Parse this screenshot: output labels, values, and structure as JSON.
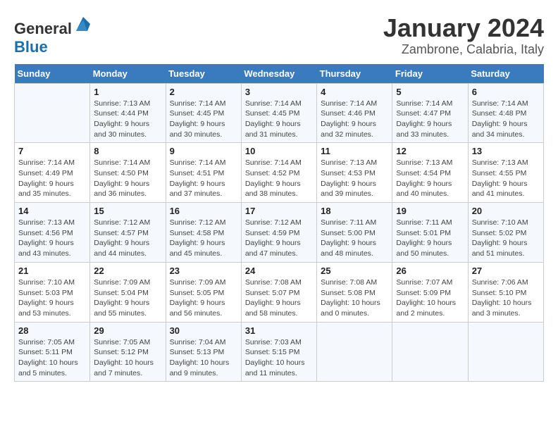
{
  "header": {
    "logo_general": "General",
    "logo_blue": "Blue",
    "title": "January 2024",
    "subtitle": "Zambrone, Calabria, Italy"
  },
  "days_of_week": [
    "Sunday",
    "Monday",
    "Tuesday",
    "Wednesday",
    "Thursday",
    "Friday",
    "Saturday"
  ],
  "weeks": [
    [
      {
        "day": "",
        "sunrise": "",
        "sunset": "",
        "daylight": ""
      },
      {
        "day": "1",
        "sunrise": "Sunrise: 7:13 AM",
        "sunset": "Sunset: 4:44 PM",
        "daylight": "Daylight: 9 hours and 30 minutes."
      },
      {
        "day": "2",
        "sunrise": "Sunrise: 7:14 AM",
        "sunset": "Sunset: 4:45 PM",
        "daylight": "Daylight: 9 hours and 30 minutes."
      },
      {
        "day": "3",
        "sunrise": "Sunrise: 7:14 AM",
        "sunset": "Sunset: 4:45 PM",
        "daylight": "Daylight: 9 hours and 31 minutes."
      },
      {
        "day": "4",
        "sunrise": "Sunrise: 7:14 AM",
        "sunset": "Sunset: 4:46 PM",
        "daylight": "Daylight: 9 hours and 32 minutes."
      },
      {
        "day": "5",
        "sunrise": "Sunrise: 7:14 AM",
        "sunset": "Sunset: 4:47 PM",
        "daylight": "Daylight: 9 hours and 33 minutes."
      },
      {
        "day": "6",
        "sunrise": "Sunrise: 7:14 AM",
        "sunset": "Sunset: 4:48 PM",
        "daylight": "Daylight: 9 hours and 34 minutes."
      }
    ],
    [
      {
        "day": "7",
        "sunrise": "Sunrise: 7:14 AM",
        "sunset": "Sunset: 4:49 PM",
        "daylight": "Daylight: 9 hours and 35 minutes."
      },
      {
        "day": "8",
        "sunrise": "Sunrise: 7:14 AM",
        "sunset": "Sunset: 4:50 PM",
        "daylight": "Daylight: 9 hours and 36 minutes."
      },
      {
        "day": "9",
        "sunrise": "Sunrise: 7:14 AM",
        "sunset": "Sunset: 4:51 PM",
        "daylight": "Daylight: 9 hours and 37 minutes."
      },
      {
        "day": "10",
        "sunrise": "Sunrise: 7:14 AM",
        "sunset": "Sunset: 4:52 PM",
        "daylight": "Daylight: 9 hours and 38 minutes."
      },
      {
        "day": "11",
        "sunrise": "Sunrise: 7:13 AM",
        "sunset": "Sunset: 4:53 PM",
        "daylight": "Daylight: 9 hours and 39 minutes."
      },
      {
        "day": "12",
        "sunrise": "Sunrise: 7:13 AM",
        "sunset": "Sunset: 4:54 PM",
        "daylight": "Daylight: 9 hours and 40 minutes."
      },
      {
        "day": "13",
        "sunrise": "Sunrise: 7:13 AM",
        "sunset": "Sunset: 4:55 PM",
        "daylight": "Daylight: 9 hours and 41 minutes."
      }
    ],
    [
      {
        "day": "14",
        "sunrise": "Sunrise: 7:13 AM",
        "sunset": "Sunset: 4:56 PM",
        "daylight": "Daylight: 9 hours and 43 minutes."
      },
      {
        "day": "15",
        "sunrise": "Sunrise: 7:12 AM",
        "sunset": "Sunset: 4:57 PM",
        "daylight": "Daylight: 9 hours and 44 minutes."
      },
      {
        "day": "16",
        "sunrise": "Sunrise: 7:12 AM",
        "sunset": "Sunset: 4:58 PM",
        "daylight": "Daylight: 9 hours and 45 minutes."
      },
      {
        "day": "17",
        "sunrise": "Sunrise: 7:12 AM",
        "sunset": "Sunset: 4:59 PM",
        "daylight": "Daylight: 9 hours and 47 minutes."
      },
      {
        "day": "18",
        "sunrise": "Sunrise: 7:11 AM",
        "sunset": "Sunset: 5:00 PM",
        "daylight": "Daylight: 9 hours and 48 minutes."
      },
      {
        "day": "19",
        "sunrise": "Sunrise: 7:11 AM",
        "sunset": "Sunset: 5:01 PM",
        "daylight": "Daylight: 9 hours and 50 minutes."
      },
      {
        "day": "20",
        "sunrise": "Sunrise: 7:10 AM",
        "sunset": "Sunset: 5:02 PM",
        "daylight": "Daylight: 9 hours and 51 minutes."
      }
    ],
    [
      {
        "day": "21",
        "sunrise": "Sunrise: 7:10 AM",
        "sunset": "Sunset: 5:03 PM",
        "daylight": "Daylight: 9 hours and 53 minutes."
      },
      {
        "day": "22",
        "sunrise": "Sunrise: 7:09 AM",
        "sunset": "Sunset: 5:04 PM",
        "daylight": "Daylight: 9 hours and 55 minutes."
      },
      {
        "day": "23",
        "sunrise": "Sunrise: 7:09 AM",
        "sunset": "Sunset: 5:05 PM",
        "daylight": "Daylight: 9 hours and 56 minutes."
      },
      {
        "day": "24",
        "sunrise": "Sunrise: 7:08 AM",
        "sunset": "Sunset: 5:07 PM",
        "daylight": "Daylight: 9 hours and 58 minutes."
      },
      {
        "day": "25",
        "sunrise": "Sunrise: 7:08 AM",
        "sunset": "Sunset: 5:08 PM",
        "daylight": "Daylight: 10 hours and 0 minutes."
      },
      {
        "day": "26",
        "sunrise": "Sunrise: 7:07 AM",
        "sunset": "Sunset: 5:09 PM",
        "daylight": "Daylight: 10 hours and 2 minutes."
      },
      {
        "day": "27",
        "sunrise": "Sunrise: 7:06 AM",
        "sunset": "Sunset: 5:10 PM",
        "daylight": "Daylight: 10 hours and 3 minutes."
      }
    ],
    [
      {
        "day": "28",
        "sunrise": "Sunrise: 7:05 AM",
        "sunset": "Sunset: 5:11 PM",
        "daylight": "Daylight: 10 hours and 5 minutes."
      },
      {
        "day": "29",
        "sunrise": "Sunrise: 7:05 AM",
        "sunset": "Sunset: 5:12 PM",
        "daylight": "Daylight: 10 hours and 7 minutes."
      },
      {
        "day": "30",
        "sunrise": "Sunrise: 7:04 AM",
        "sunset": "Sunset: 5:13 PM",
        "daylight": "Daylight: 10 hours and 9 minutes."
      },
      {
        "day": "31",
        "sunrise": "Sunrise: 7:03 AM",
        "sunset": "Sunset: 5:15 PM",
        "daylight": "Daylight: 10 hours and 11 minutes."
      },
      {
        "day": "",
        "sunrise": "",
        "sunset": "",
        "daylight": ""
      },
      {
        "day": "",
        "sunrise": "",
        "sunset": "",
        "daylight": ""
      },
      {
        "day": "",
        "sunrise": "",
        "sunset": "",
        "daylight": ""
      }
    ]
  ]
}
